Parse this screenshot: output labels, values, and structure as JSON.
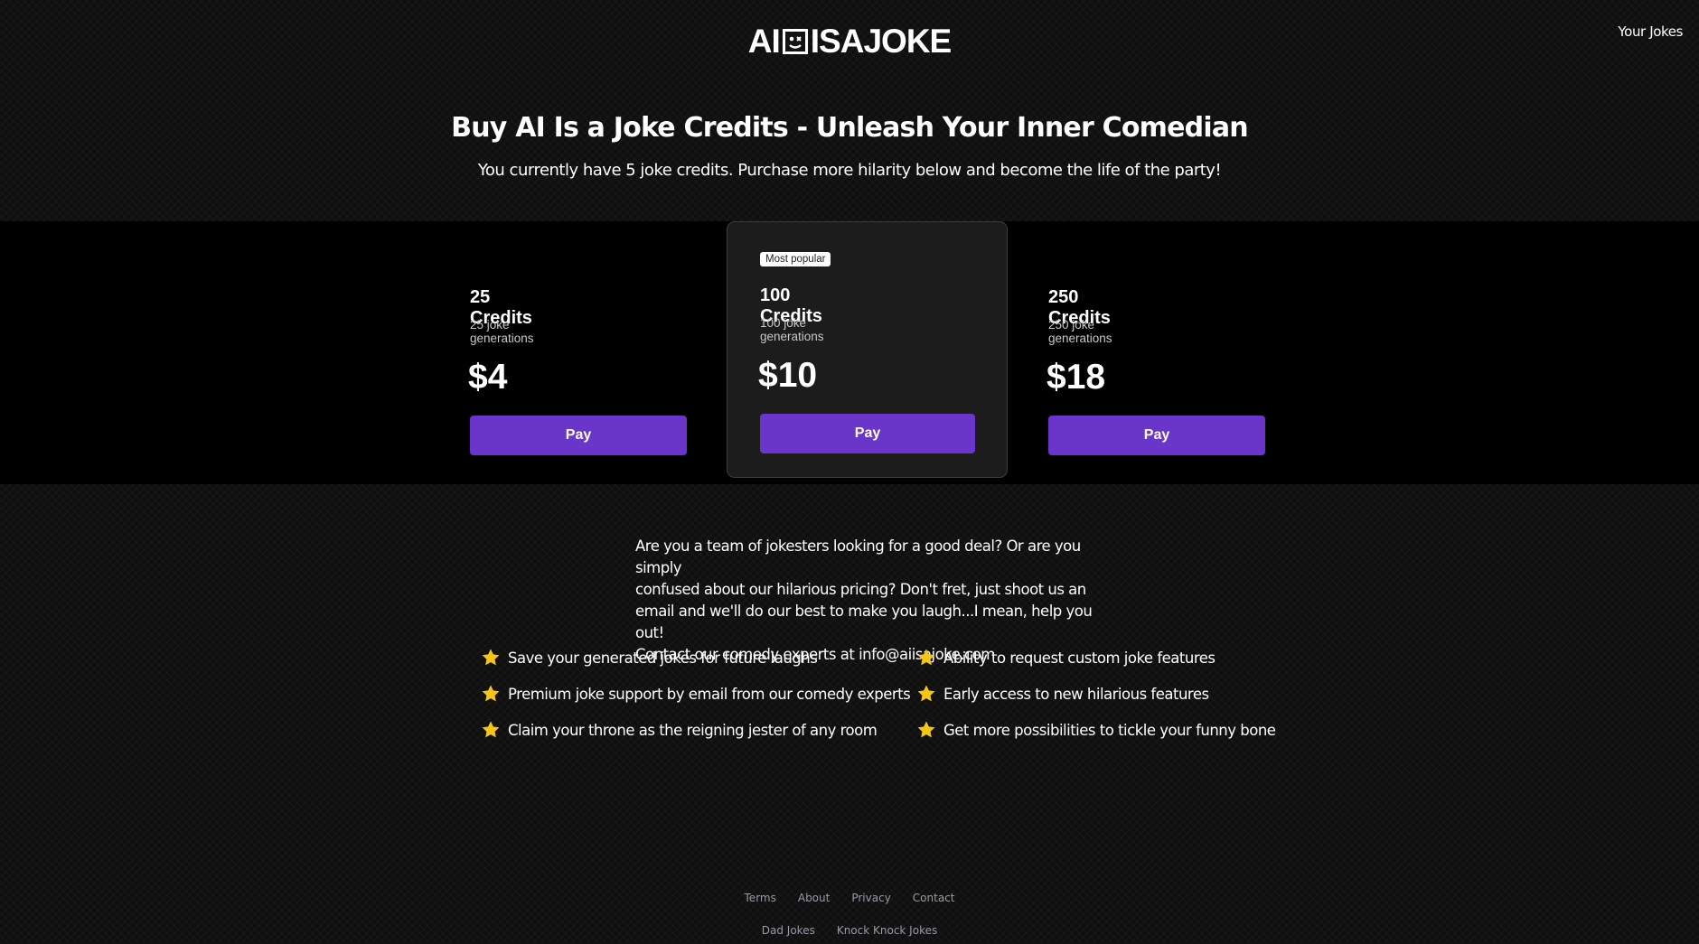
{
  "header": {
    "logo_left": "AI",
    "logo_right": "ISAJOKE",
    "nav_link": "Your Jokes"
  },
  "hero": {
    "title": "Buy AI Is a Joke Credits - Unleash Your Inner Comedian",
    "subtitle": "You currently have 5 joke credits. Purchase more hilarity below and become the life of the party!"
  },
  "plans": [
    {
      "name": "25 Credits",
      "desc": "25 joke generations",
      "price": "$4",
      "button": "Pay"
    },
    {
      "name": "100 Credits",
      "desc": "100 joke generations",
      "price": "$10",
      "button": "Pay",
      "badge": "Most popular"
    },
    {
      "name": "250 Credits",
      "desc": "250 joke generations",
      "price": "$18",
      "button": "Pay"
    }
  ],
  "contact": {
    "line1": "Are you a team of jokesters looking for a good deal? Or are you simply",
    "line2": "confused about our hilarious pricing? Don't fret, just shoot us an",
    "line3": "email and we'll do our best to make you laugh...I mean, help you out!",
    "line4": "Contact our comedy experts at info@aiisajoke.com"
  },
  "features": {
    "left": [
      "Save your generated jokes for future laughs",
      "Premium joke support by email from our comedy experts",
      "Claim your throne as the reigning jester of any room"
    ],
    "right": [
      "Ability to request custom joke features",
      "Early access to new hilarious features",
      "Get more possibilities to tickle your funny bone"
    ],
    "icon": "star-icon",
    "icon_color": "#f5c518"
  },
  "footer": {
    "row1": [
      "Terms",
      "About",
      "Privacy",
      "Contact"
    ],
    "row2": [
      "Dad Jokes",
      "Knock Knock Jokes"
    ]
  },
  "colors": {
    "accent": "#6a35c9",
    "background": "#0f0f0f",
    "band": "#000000",
    "featured_card": "#1c1c1c"
  }
}
